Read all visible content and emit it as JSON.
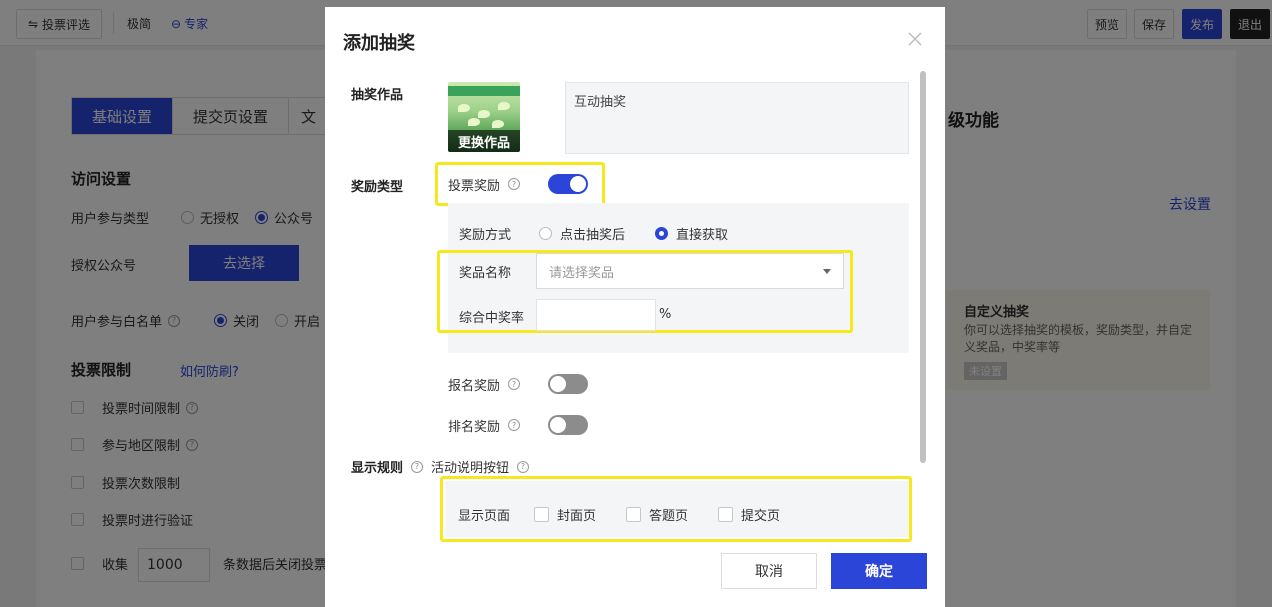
{
  "topbar": {
    "vote_review": "投票评选",
    "minimal": "极简",
    "expert": "专家",
    "preview": "预览",
    "save": "保存",
    "publish": "发布",
    "exit": "退出"
  },
  "background": {
    "tabs": [
      "基础设置",
      "提交页设置",
      "文"
    ],
    "right_heading": "级功能",
    "access_settings": "访问设置",
    "participation_type": "用户参与类型",
    "no_auth": "无授权",
    "official_account": "公众号",
    "auth_account": "授权公众号",
    "choose_btn": "去选择",
    "whitelist": "用户参与白名单",
    "off": "关闭",
    "on": "开启",
    "go_settings": "去设置",
    "vote_limits": "投票限制",
    "anti_fraud": "如何防刷?",
    "time_limit": "投票时间限制",
    "region_limit": "参与地区限制",
    "count_limit": "投票次数限制",
    "verify": "投票时进行验证",
    "collect": "收集",
    "collect_value": "1000",
    "collect_suffix": "条数据后关闭投票",
    "custom_lottery_title": "自定义抽奖",
    "custom_lottery_desc": "你可以选择抽奖的模板，奖励类型，并自定义奖品，中奖率等",
    "not_set": "未设置"
  },
  "modal": {
    "title": "添加抽奖",
    "lottery_work_label": "抽奖作品",
    "change_work": "更换作品",
    "work_name": "互动抽奖",
    "reward_type_label": "奖励类型",
    "vote_reward": "投票奖励",
    "reward_method": "奖励方式",
    "after_click": "点击抽奖后",
    "direct_get": "直接获取",
    "prize_name": "奖品名称",
    "prize_placeholder": "请选择奖品",
    "win_rate": "综合中奖率",
    "percent": "%",
    "signup_reward": "报名奖励",
    "rank_reward": "排名奖励",
    "display_rules": "显示规则",
    "activity_desc_btn": "活动说明按钮",
    "display_page": "显示页面",
    "cover_page": "封面页",
    "question_page": "答题页",
    "submit_page": "提交页",
    "cancel": "取消",
    "confirm": "确定"
  },
  "state": {
    "vote_reward_on": true,
    "signup_reward_on": false,
    "rank_reward_on": false,
    "reward_method_selected": "直接获取"
  },
  "colors": {
    "primary": "#2b45d8",
    "highlight": "#f5e81f"
  }
}
